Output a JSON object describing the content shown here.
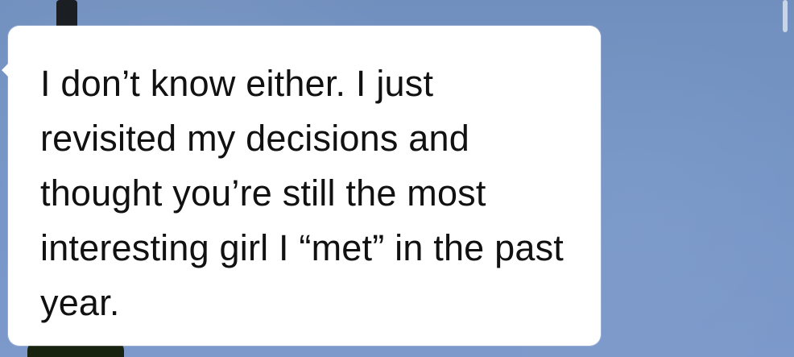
{
  "chat": {
    "message": "I don’t know either. I just revisited my decisions and thought you’re still the most interesting girl I “met” in the past year."
  }
}
